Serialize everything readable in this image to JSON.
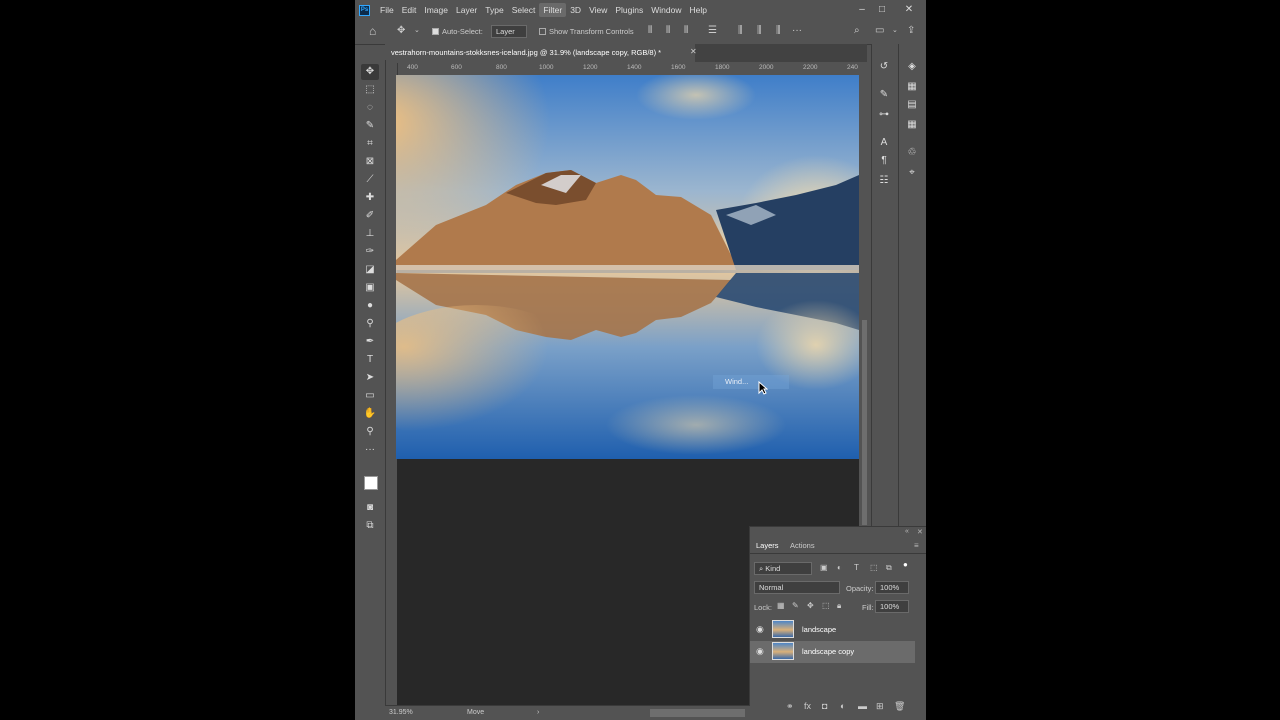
{
  "app": {
    "logo": "Ps",
    "menu": [
      "File",
      "Edit",
      "Image",
      "Layer",
      "Type",
      "Select",
      "Filter",
      "3D",
      "View",
      "Plugins",
      "Window",
      "Help"
    ],
    "active_menu": "Filter",
    "window_controls": [
      "–",
      "□",
      "✕"
    ]
  },
  "options_bar": {
    "auto_select_label": "Auto-Select:",
    "auto_select_value": "Layer",
    "show_transform_label": "Show Transform Controls"
  },
  "document": {
    "tab_title": "vestrahorn-mountains-stokksnes-iceland.jpg @ 31.9% (landscape copy, RGB/8) *",
    "ruler_numbers": [
      "400",
      "600",
      "800",
      "1000",
      "1200",
      "1400",
      "1600",
      "1800",
      "2000",
      "2200",
      "240"
    ]
  },
  "tooltip": {
    "text": "Wind..."
  },
  "status_bar": {
    "zoom": "31.95%",
    "tool": "Move",
    "arrow": "›"
  },
  "layers_panel": {
    "tabs": [
      "Layers",
      "Actions"
    ],
    "filter_kind": "Kind",
    "blend_mode": "Normal",
    "opacity_label": "Opacity:",
    "opacity_value": "100%",
    "lock_label": "Lock:",
    "fill_label": "Fill:",
    "fill_value": "100%",
    "layers": [
      {
        "name": "landscape",
        "selected": false
      },
      {
        "name": "landscape copy",
        "selected": true
      }
    ]
  },
  "colors": {
    "ui_bg": "#535353",
    "canvas_bg": "#282828",
    "accent": "#31a8ff",
    "selected_layer": "#6b6b6b"
  }
}
